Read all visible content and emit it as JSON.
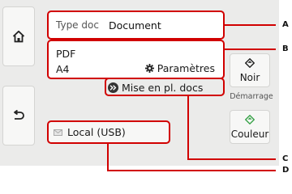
{
  "left": {
    "home_icon": "home-icon",
    "back_icon": "back-arrow-icon"
  },
  "main": {
    "type_label": "Type doc",
    "type_value": "Document",
    "format": "PDF",
    "paper": "A4",
    "settings_label": "Paramètres",
    "mise_label": "Mise en pl. docs",
    "destination": "Local (USB)"
  },
  "right": {
    "noir_label": "Noir",
    "start_label": "Démarrage",
    "couleur_label": "Couleur"
  },
  "callouts": [
    "A",
    "B",
    "C",
    "D"
  ],
  "colors": {
    "callout": "#d10000",
    "couleur_icon": "#3aa34a"
  }
}
